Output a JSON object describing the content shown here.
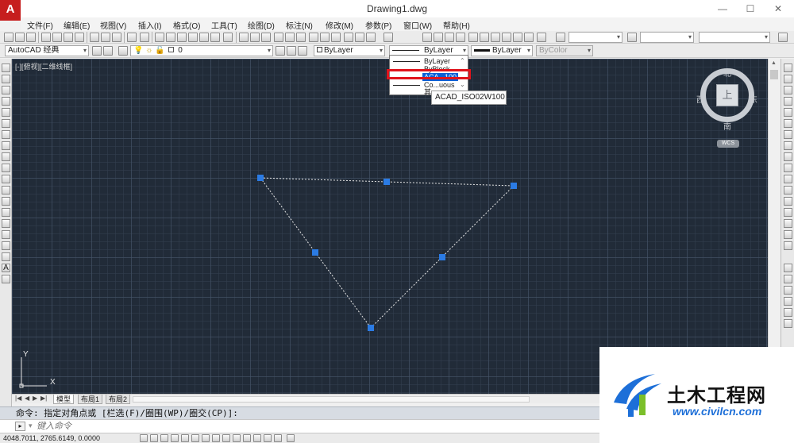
{
  "app": {
    "title": "Drawing1.dwg",
    "logo_letter": "A",
    "win_controls": [
      "—",
      "☐",
      "✕"
    ]
  },
  "menu": [
    "文件(F)",
    "编辑(E)",
    "视图(V)",
    "插入(I)",
    "格式(O)",
    "工具(T)",
    "绘图(D)",
    "标注(N)",
    "修改(M)",
    "参数(P)",
    "窗口(W)",
    "帮助(H)"
  ],
  "toolbar": {
    "workspace": "AutoCAD 经典",
    "layer": "0",
    "color": "ByLayer",
    "linetype": "ByLayer",
    "lineweight": "ByLayer",
    "plotstyle": "ByColor"
  },
  "viewport": {
    "label": "[-][俯视][二维线框]"
  },
  "viewcube": {
    "face": "上",
    "north": "北",
    "south": "南",
    "east": "东",
    "west": "西",
    "wcs": "WCS"
  },
  "linetype_dropdown": {
    "items": [
      "ByLayer",
      "ByBlock",
      "ACAD_ISO02W100",
      "Continuous",
      "其他..."
    ],
    "visible_texts": [
      "ByLayer",
      "ByBlock",
      "ACA...100",
      "Co...uous",
      "其"
    ],
    "highlighted_index": 2,
    "tooltip": "ACAD_ISO02W100"
  },
  "ucs": {
    "x_label": "X",
    "y_label": "Y"
  },
  "layout_tabs": [
    "模型",
    "布局1",
    "布局2"
  ],
  "command": {
    "history": "命令: 指定对角点或 [栏选(F)/圈围(WP)/圈交(CP)]:",
    "placeholder": "键入命令"
  },
  "status": {
    "coords": "4048.7011, 2765.6149, 0.0000"
  },
  "watermark": {
    "brand": "土木工程网",
    "url": "www.civilcn.com"
  },
  "colors": {
    "canvas_bg": "#212b38",
    "grip": "#2b7be4",
    "highlight_border": "#e0141c",
    "dropdown_selection": "#0a5fd6",
    "watermark_blue": "#1d6fd8",
    "watermark_green": "#7bbf2a"
  }
}
